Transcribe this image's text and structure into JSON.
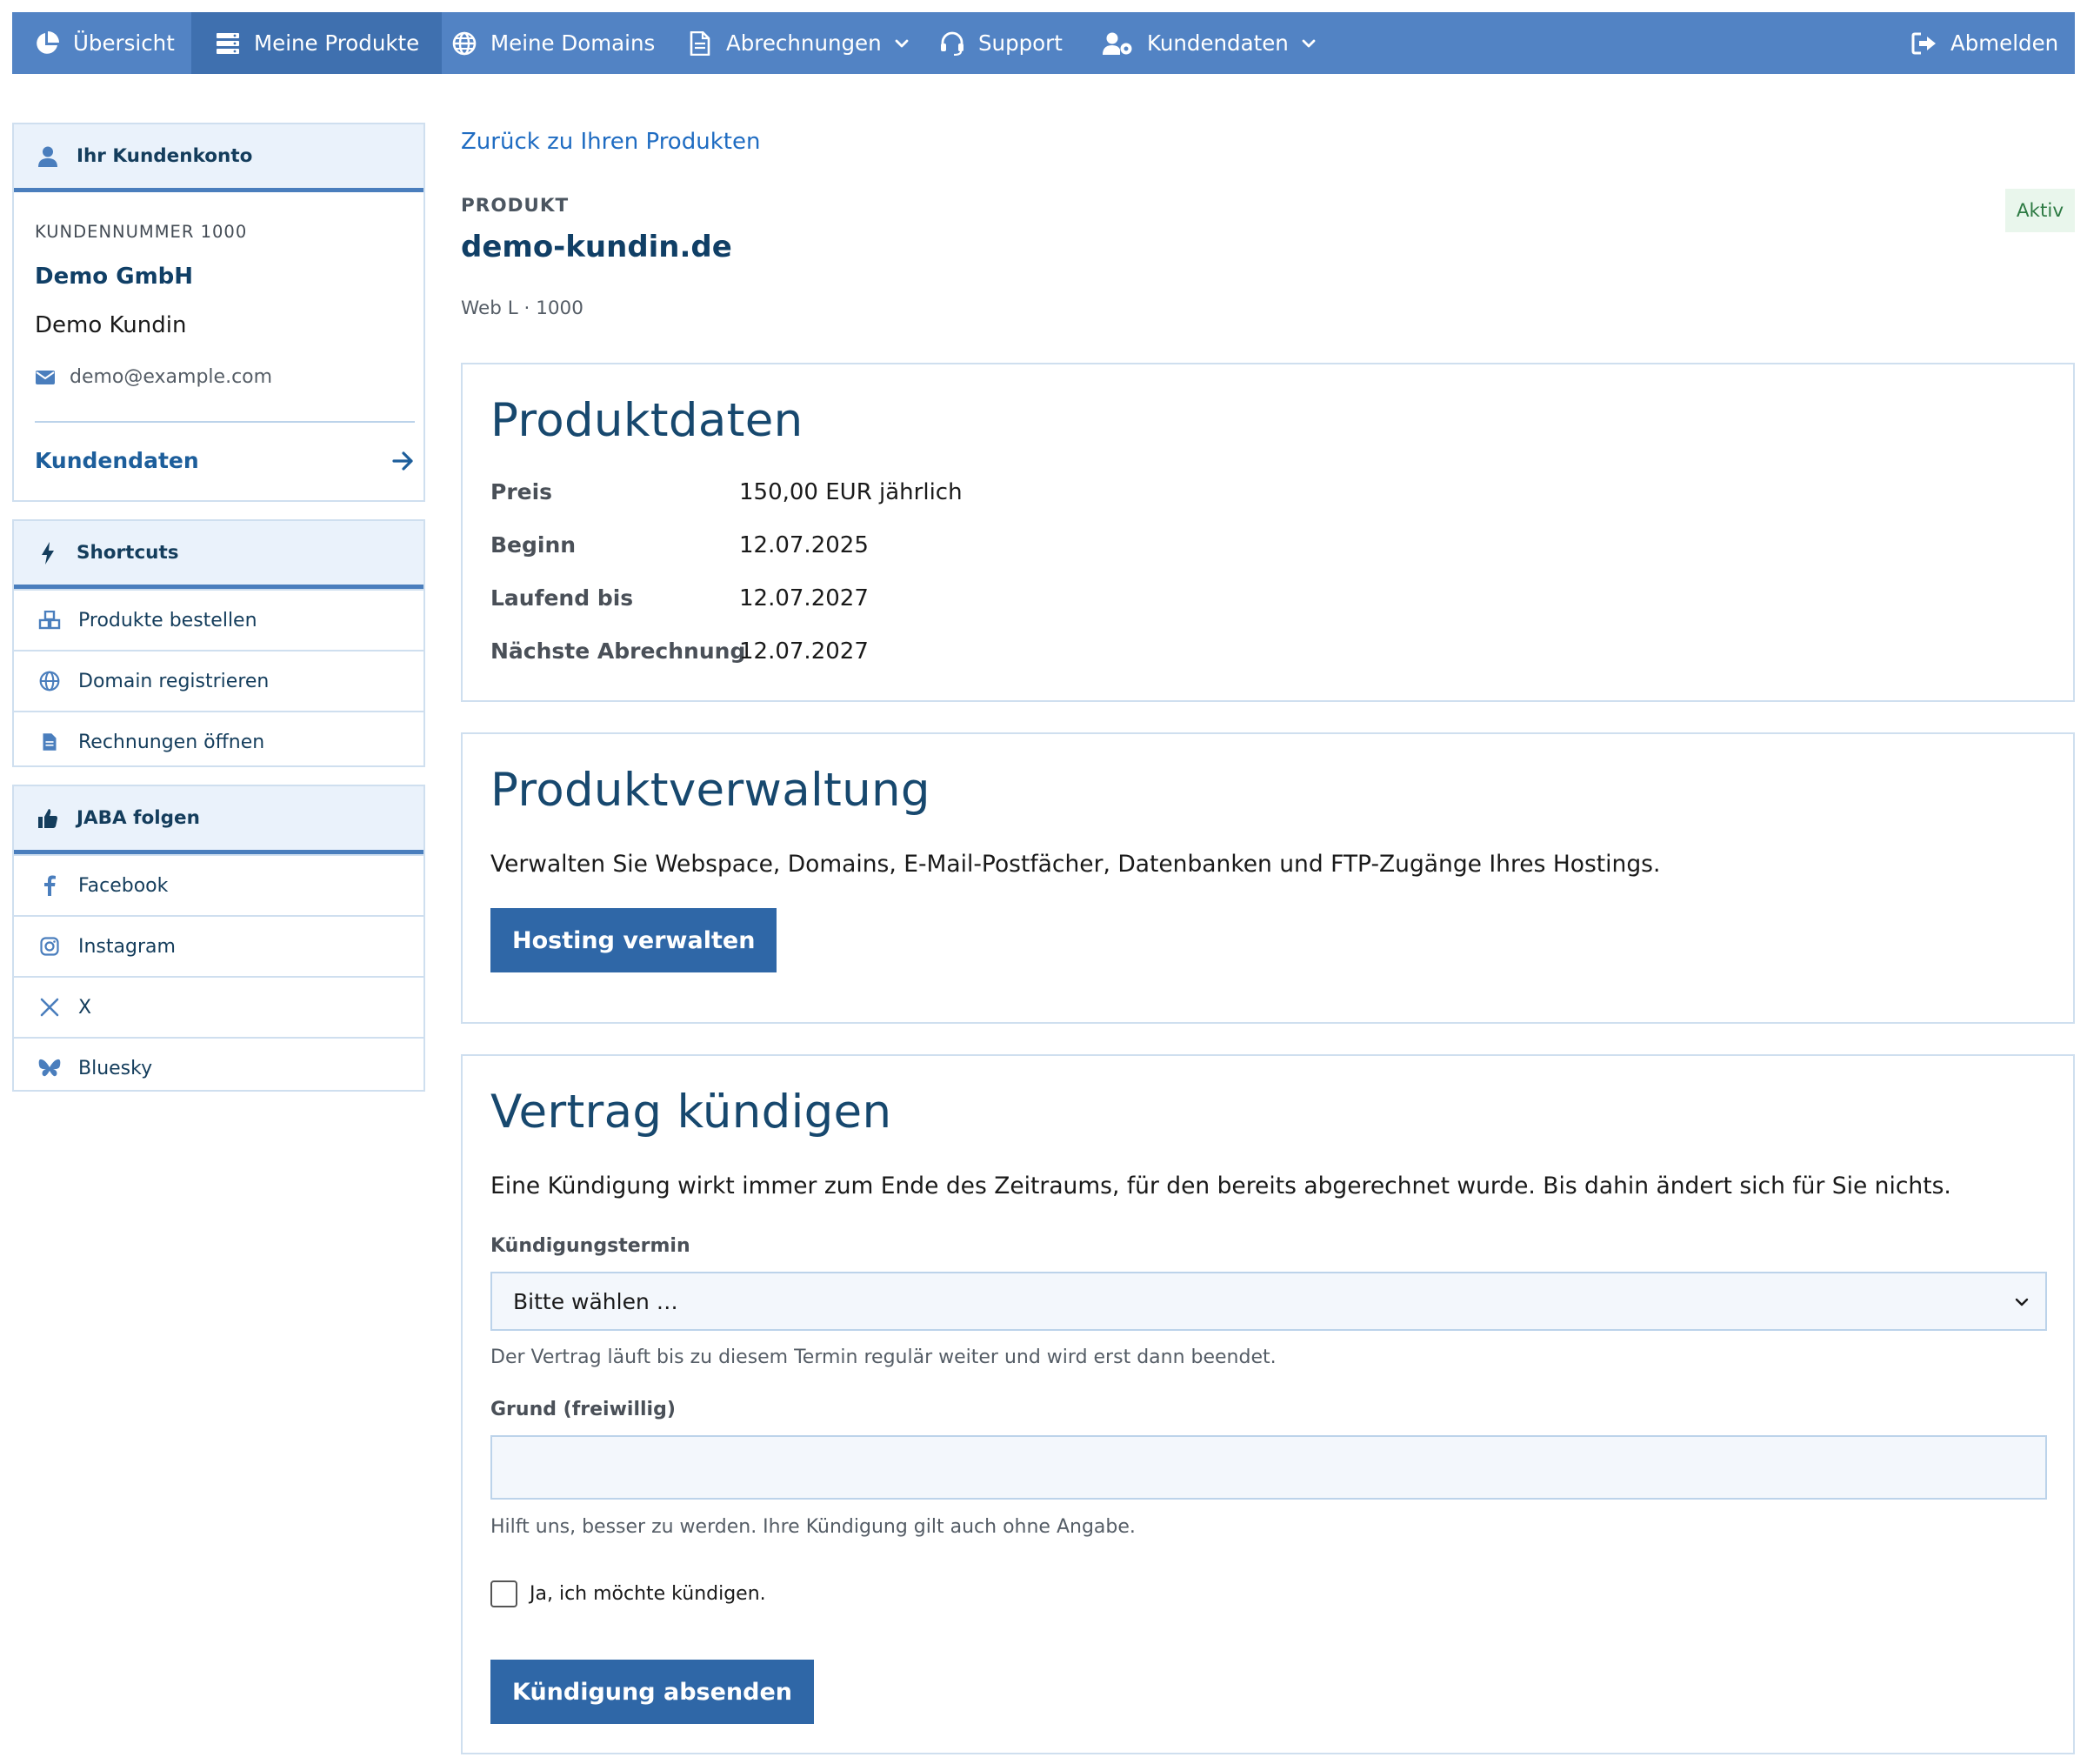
{
  "nav": {
    "items": [
      {
        "label": "Übersicht",
        "icon": "chart-pie-icon"
      },
      {
        "label": "Meine Produkte",
        "icon": "server-icon",
        "active": true
      },
      {
        "label": "Meine Domains",
        "icon": "globe-icon"
      },
      {
        "label": "Abrechnungen",
        "icon": "document-icon",
        "dropdown": true
      },
      {
        "label": "Support",
        "icon": "headset-icon"
      },
      {
        "label": "Kundendaten",
        "icon": "user-gear-icon",
        "dropdown": true
      }
    ],
    "logout": {
      "label": "Abmelden",
      "icon": "sign-out-icon"
    }
  },
  "sidebar": {
    "account": {
      "heading": "Ihr Kundenkonto",
      "customer_number": "KUNDENNUMMER 1000",
      "company": "Demo GmbH",
      "name": "Demo Kundin",
      "email": "demo@example.com",
      "link": "Kundendaten"
    },
    "shortcuts": {
      "heading": "Shortcuts",
      "items": [
        {
          "label": "Produkte bestellen",
          "icon": "cubes-icon"
        },
        {
          "label": "Domain registrieren",
          "icon": "globe-icon"
        },
        {
          "label": "Rechnungen öffnen",
          "icon": "document-icon"
        }
      ]
    },
    "follow": {
      "heading": "JABA folgen",
      "items": [
        {
          "label": "Facebook",
          "icon": "facebook-icon"
        },
        {
          "label": "Instagram",
          "icon": "instagram-icon"
        },
        {
          "label": "X",
          "icon": "x-icon"
        },
        {
          "label": "Bluesky",
          "icon": "bluesky-icon"
        }
      ]
    }
  },
  "main": {
    "back_link": "Zurück zu Ihren Produkten",
    "product_label": "PRODUKT",
    "product_title": "demo-kundin.de",
    "product_sub": "Web L · 1000",
    "status": "Aktiv",
    "product_data": {
      "title": "Produktdaten",
      "rows": [
        {
          "label": "Preis",
          "value": "150,00 EUR jährlich"
        },
        {
          "label": "Beginn",
          "value": "12.07.2025"
        },
        {
          "label": "Laufend bis",
          "value": "12.07.2027"
        },
        {
          "label": "Nächste Abrechnung",
          "value": "12.07.2027"
        }
      ]
    },
    "management": {
      "title": "Produktverwaltung",
      "text": "Verwalten Sie Webspace, Domains, E-Mail-Postfächer, Datenbanken und FTP-Zugänge Ihres Hostings.",
      "button": "Hosting verwalten"
    },
    "cancel": {
      "title": "Vertrag kündigen",
      "text": "Eine Kündigung wirkt immer zum Ende des Zeitraums, für den bereits abgerechnet wurde. Bis dahin ändert sich für Sie nichts.",
      "date_label": "Kündigungstermin",
      "date_value": "Bitte wählen …",
      "date_hint": "Der Vertrag läuft bis zu diesem Termin regulär weiter und wird erst dann beendet.",
      "reason_label": "Grund (freiwillig)",
      "reason_value": "",
      "reason_hint": "Hilft uns, besser zu werden. Ihre Kündigung gilt auch ohne Angabe.",
      "confirm_label": "Ja, ich möchte kündigen.",
      "confirm_checked": false,
      "submit": "Kündigung absenden"
    }
  },
  "colors": {
    "nav_bg": "#5283c4",
    "nav_active": "#3f70af",
    "button": "#2f67a7",
    "heading_dark": "#103f66",
    "link": "#1f6cc2",
    "border": "#cfdfef",
    "status_bg": "#e9f6ec",
    "status_text": "#2d7a43"
  }
}
